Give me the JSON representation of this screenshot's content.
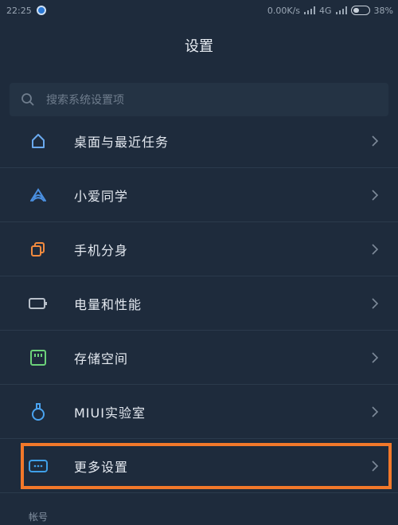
{
  "status_bar": {
    "time": "22:25",
    "network_speed": "0.00K/s",
    "network_type": "4G",
    "battery": "38%"
  },
  "header": {
    "title": "设置"
  },
  "search": {
    "placeholder": "搜索系统设置项"
  },
  "settings_items": [
    {
      "label": "桌面与最近任务",
      "icon": "home-icon",
      "color": "#6aa9ee"
    },
    {
      "label": "小爱同学",
      "icon": "xiaoai-icon",
      "color": "#4a8fe0"
    },
    {
      "label": "手机分身",
      "icon": "dual-phone-icon",
      "color": "#f28a3e"
    },
    {
      "label": "电量和性能",
      "icon": "battery-icon",
      "color": "#b8c0ca"
    },
    {
      "label": "存储空间",
      "icon": "storage-icon",
      "color": "#6cd27a"
    },
    {
      "label": "MIUI实验室",
      "icon": "lab-flask-icon",
      "color": "#4aa3f0"
    },
    {
      "label": "更多设置",
      "icon": "more-settings-icon",
      "color": "#3fa0e8"
    }
  ],
  "section": {
    "account_label": "帐号"
  },
  "colors": {
    "background": "#1e2b3c",
    "highlight": "#f2782a"
  }
}
